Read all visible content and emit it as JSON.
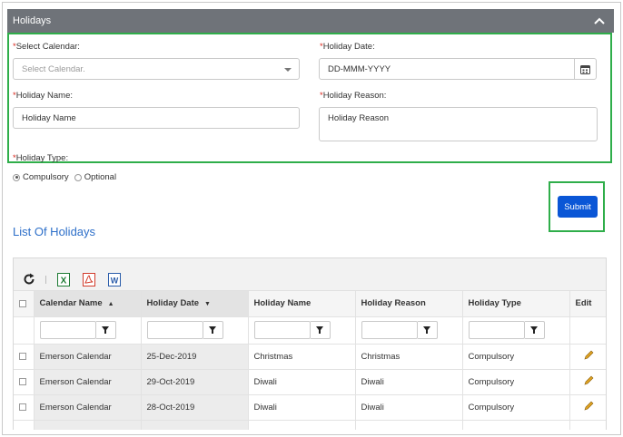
{
  "panel": {
    "title": "Holidays"
  },
  "form": {
    "calendar": {
      "required_mark": "*",
      "label": "Select Calendar:",
      "placeholder": "Select Calendar."
    },
    "date": {
      "required_mark": "*",
      "label": "Holiday Date:",
      "placeholder": "DD-MMM-YYYY"
    },
    "name": {
      "required_mark": "*",
      "label": "Holiday Name:",
      "placeholder": "Holiday Name"
    },
    "reason": {
      "required_mark": "*",
      "label": "Holiday Reason:",
      "placeholder": "Holiday Reason"
    },
    "type": {
      "required_mark": "*",
      "label": "Holiday Type:",
      "options": [
        {
          "label": "Compulsory",
          "selected": true
        },
        {
          "label": "Optional",
          "selected": false
        }
      ]
    },
    "submit_label": "Submit"
  },
  "list": {
    "title": "List Of Holidays",
    "toolbar_icons": [
      "refresh-icon",
      "excel-export-icon",
      "pdf-export-icon",
      "word-export-icon"
    ],
    "columns": [
      {
        "label": "Calendar Name",
        "sort": "▲"
      },
      {
        "label": "Holiday Date",
        "sort": "▼"
      },
      {
        "label": "Holiday Name",
        "sort": ""
      },
      {
        "label": "Holiday Reason",
        "sort": ""
      },
      {
        "label": "Holiday Type",
        "sort": ""
      },
      {
        "label": "Edit",
        "sort": ""
      }
    ],
    "rows": [
      {
        "calendar": "Emerson Calendar",
        "date": "25-Dec-2019",
        "name": "Christmas",
        "reason": "Christmas",
        "type": "Compulsory"
      },
      {
        "calendar": "Emerson Calendar",
        "date": "29-Oct-2019",
        "name": "Diwali",
        "reason": "Diwali",
        "type": "Compulsory"
      },
      {
        "calendar": "Emerson Calendar",
        "date": "28-Oct-2019",
        "name": "Diwali",
        "reason": "Diwali",
        "type": "Compulsory"
      }
    ]
  },
  "colors": {
    "header_bg": "#6f7379",
    "highlight_border": "#2fae4a",
    "submit_bg": "#0a56d6",
    "list_title": "#2d6fc9",
    "required": "#d9281e",
    "edit_icon": "#e0a321"
  }
}
